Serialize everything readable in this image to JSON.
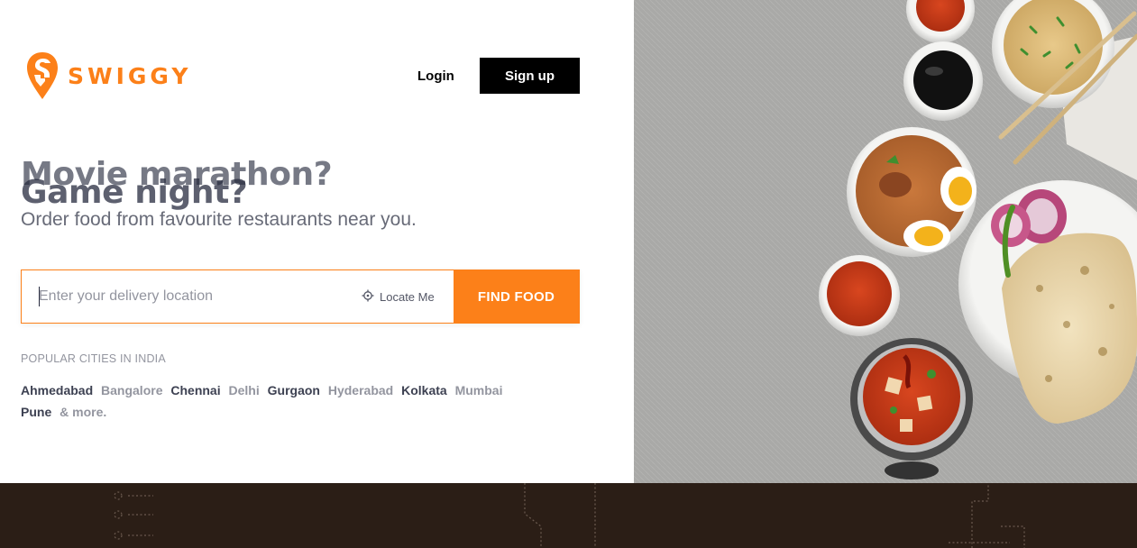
{
  "brand": {
    "name": "SWIGGY",
    "color": "#fc8019"
  },
  "header": {
    "login_label": "Login",
    "signup_label": "Sign up"
  },
  "hero": {
    "headline_back": "Movie marathon?",
    "headline_front": "Game night?",
    "subtitle": "Order food from favourite restaurants near you."
  },
  "search": {
    "placeholder": "Enter your delivery location",
    "value": "",
    "locate_label": "Locate Me",
    "submit_label": "FIND FOOD"
  },
  "popular": {
    "title": "POPULAR CITIES IN INDIA",
    "cities": [
      "Ahmedabad",
      "Bangalore",
      "Chennai",
      "Delhi",
      "Gurgaon",
      "Hyderabad",
      "Kolkata",
      "Mumbai",
      "Pune"
    ],
    "more_label": "& more."
  },
  "colors": {
    "accent": "#fc8019",
    "dark_text": "#282c3f",
    "muted_text": "#93959f",
    "footer_bg": "#2b1e16"
  },
  "icons": [
    "swiggy-logo-icon",
    "locate-me-icon"
  ]
}
